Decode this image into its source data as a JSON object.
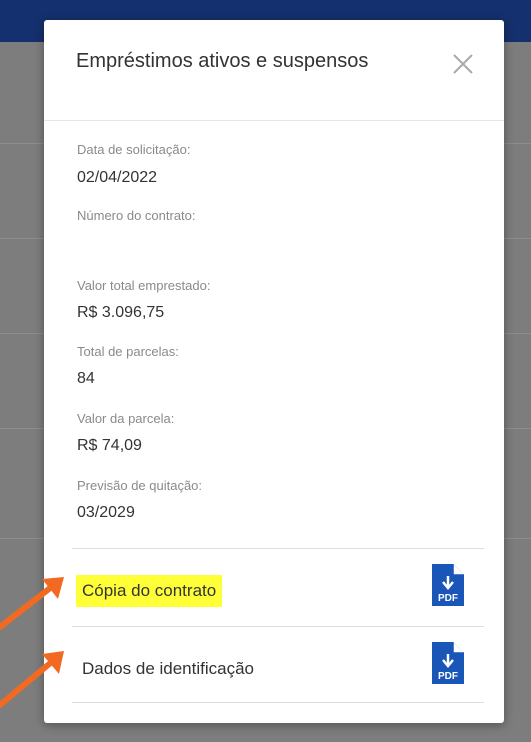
{
  "modal": {
    "title": "Empréstimos ativos e suspensos",
    "close_icon": "close-icon",
    "fields": [
      {
        "label": "Data de solicitação:",
        "value": "02/04/2022"
      },
      {
        "label": "Número do contrato:",
        "value": ""
      },
      {
        "label": "Valor total emprestado:",
        "value": "R$ 3.096,75"
      },
      {
        "label": "Total de parcelas:",
        "value": "84"
      },
      {
        "label": "Valor da parcela:",
        "value": "R$ 74,09"
      },
      {
        "label": "Previsão de quitação:",
        "value": "03/2029"
      }
    ],
    "documents": [
      {
        "label": "Cópia do contrato",
        "icon": "pdf-download-icon",
        "highlighted": true
      },
      {
        "label": "Dados de identificação",
        "icon": "pdf-download-icon",
        "highlighted": false
      }
    ],
    "pdf_icon_text": "PDF"
  },
  "colors": {
    "header_bar": "#15306e",
    "overlay": "#7d7d7d",
    "pdf_icon": "#1a56b8",
    "highlight": "#ffff38",
    "arrow": "#f26a21"
  }
}
